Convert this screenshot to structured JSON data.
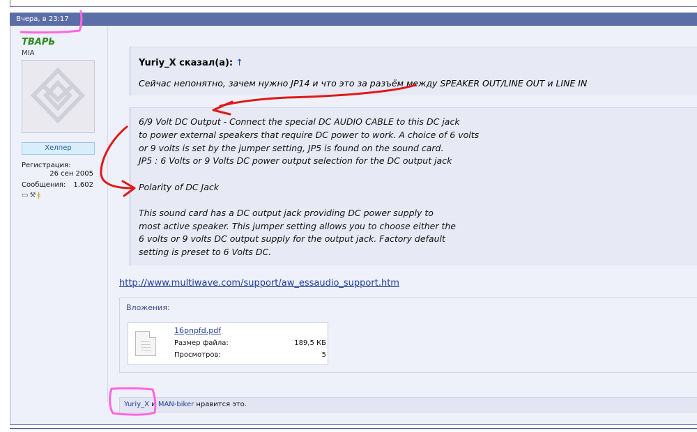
{
  "post": {
    "timestamp": "Вчера, в 23:17"
  },
  "user": {
    "name": "ТВАРЬ",
    "title": "MIA",
    "rank": "Хелпер",
    "reg_label": "Регистрация:",
    "reg_value": "26 сен 2005",
    "msgs_label": "Сообщения:",
    "msgs_value": "1.602"
  },
  "quote": {
    "author": "Yuriy_X сказал(а):",
    "arrow": "↑",
    "text": "Сейчас непонятно, зачем нужно JP14 и что это за разъём между SPEAKER OUT/LINE OUT и LINE IN"
  },
  "block": {
    "lines": [
      "6/9 Volt DC Output - Connect the special DC AUDIO CABLE to this DC jack",
      "to power external speakers that require DC power to work. A choice of 6 volts",
      "or 9 volts is set by the jumper setting, JP5 is found on the sound card.",
      "JP5 : 6 Volts or 9 Volts DC power output selection for the DC output jack",
      "Polarity of DC Jack",
      "This sound card has a DC output jack providing DC power supply to",
      "most active speaker. This jumper setting allows you to choose either the",
      "6 volts or 9 volts DC output supply for the output jack. Factory default",
      "setting is preset to 6 Volts DC."
    ]
  },
  "link": "http://www.multiwave.com/support/aw_essaudio_support.htm",
  "attachments": {
    "title": "Вложения:",
    "file_name": "16pnpfd.pdf",
    "size_label": "Размер файла:",
    "size_value": "189,5 КБ",
    "views_label": "Просмотров:",
    "views_value": "5"
  },
  "likes": {
    "user1": "Yuriy_X",
    "conj": " и ",
    "user2": "MAN-biker",
    "suffix": " нравится это."
  },
  "colors": {
    "header": "#5c6ea7",
    "username": "#2b8a1e",
    "annotation_red": "#e01818",
    "highlight_pink": "#ff66e0"
  }
}
